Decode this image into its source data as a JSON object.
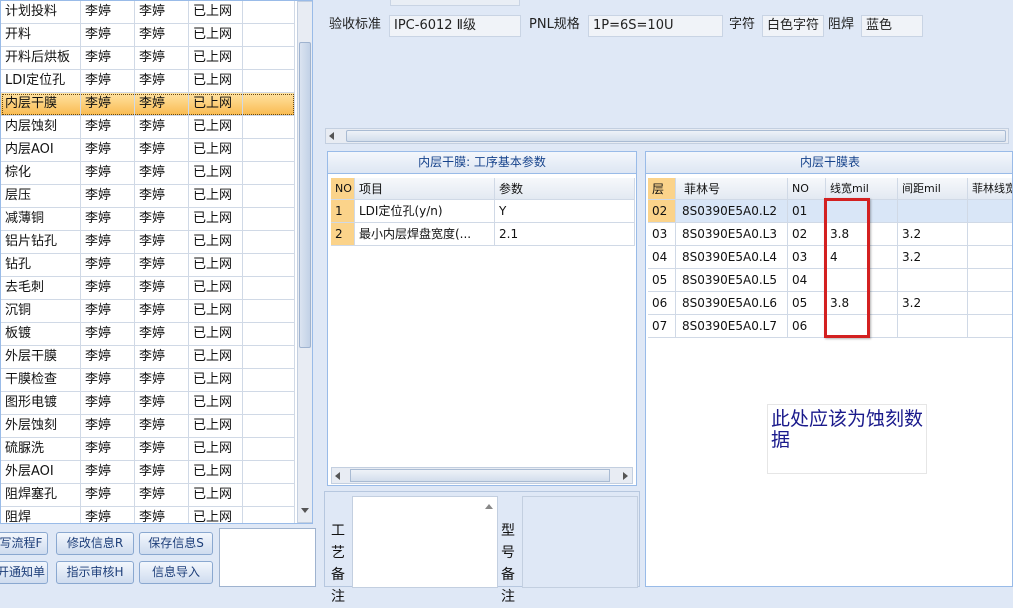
{
  "process_list": [
    {
      "step": "计划投料",
      "a": "李婷",
      "b": "李婷",
      "status": "已上网"
    },
    {
      "step": "开料",
      "a": "李婷",
      "b": "李婷",
      "status": "已上网"
    },
    {
      "step": "开料后烘板",
      "a": "李婷",
      "b": "李婷",
      "status": "已上网"
    },
    {
      "step": "LDI定位孔",
      "a": "李婷",
      "b": "李婷",
      "status": "已上网"
    },
    {
      "step": "内层干膜",
      "a": "李婷",
      "b": "李婷",
      "status": "已上网"
    },
    {
      "step": "内层蚀刻",
      "a": "李婷",
      "b": "李婷",
      "status": "已上网"
    },
    {
      "step": "内层AOI",
      "a": "李婷",
      "b": "李婷",
      "status": "已上网"
    },
    {
      "step": "棕化",
      "a": "李婷",
      "b": "李婷",
      "status": "已上网"
    },
    {
      "step": "层压",
      "a": "李婷",
      "b": "李婷",
      "status": "已上网"
    },
    {
      "step": "减薄铜",
      "a": "李婷",
      "b": "李婷",
      "status": "已上网"
    },
    {
      "step": "铝片钻孔",
      "a": "李婷",
      "b": "李婷",
      "status": "已上网"
    },
    {
      "step": "钻孔",
      "a": "李婷",
      "b": "李婷",
      "status": "已上网"
    },
    {
      "step": "去毛刺",
      "a": "李婷",
      "b": "李婷",
      "status": "已上网"
    },
    {
      "step": "沉铜",
      "a": "李婷",
      "b": "李婷",
      "status": "已上网"
    },
    {
      "step": "板镀",
      "a": "李婷",
      "b": "李婷",
      "status": "已上网"
    },
    {
      "step": "外层干膜",
      "a": "李婷",
      "b": "李婷",
      "status": "已上网"
    },
    {
      "step": "干膜检查",
      "a": "李婷",
      "b": "李婷",
      "status": "已上网"
    },
    {
      "step": "图形电镀",
      "a": "李婷",
      "b": "李婷",
      "status": "已上网"
    },
    {
      "step": "外层蚀刻",
      "a": "李婷",
      "b": "李婷",
      "status": "已上网"
    },
    {
      "step": "硫脲洗",
      "a": "李婷",
      "b": "李婷",
      "status": "已上网"
    },
    {
      "step": "外层AOI",
      "a": "李婷",
      "b": "李婷",
      "status": "已上网"
    },
    {
      "step": "阻焊塞孔",
      "a": "李婷",
      "b": "李婷",
      "status": "已上网"
    },
    {
      "step": "阻焊",
      "a": "李婷",
      "b": "李婷",
      "status": "已上网"
    }
  ],
  "selected_process_index": 4,
  "buttons": {
    "flow": "写流程F",
    "modify": "修改信息R",
    "save": "保存信息S",
    "notify": "开通知单",
    "review": "指示审核H",
    "import": "信息导入"
  },
  "spec": {
    "accept_label": "验收标准",
    "accept_value": "IPC-6012 Ⅱ级",
    "pnl_label": "PNL规格",
    "pnl_value": "1P=6S=10U",
    "char_label": "字符",
    "char_value": "白色字符",
    "mask_label": "阻焊",
    "mask_value": "蓝色"
  },
  "params_panel": {
    "title": "内层干膜: 工序基本参数",
    "columns": [
      "NO",
      "项目",
      "参数"
    ],
    "rows": [
      {
        "no": "1",
        "item": "LDI定位孔(y/n)",
        "value": "Y"
      },
      {
        "no": "2",
        "item": "最小内层焊盘宽度(...",
        "value": "2.1"
      }
    ]
  },
  "film_table": {
    "title": "内层干膜表",
    "columns": [
      "层",
      "菲林号",
      "NO",
      "线宽mil",
      "间距mil",
      "菲林线宽"
    ],
    "rows": [
      {
        "layer": "02",
        "film": "8S0390E5A0.L2",
        "no": "01",
        "width": "",
        "spacing": ""
      },
      {
        "layer": "03",
        "film": "8S0390E5A0.L3",
        "no": "02",
        "width": "3.8",
        "spacing": "3.2"
      },
      {
        "layer": "04",
        "film": "8S0390E5A0.L4",
        "no": "03",
        "width": "4",
        "spacing": "3.2"
      },
      {
        "layer": "05",
        "film": "8S0390E5A0.L5",
        "no": "04",
        "width": "",
        "spacing": ""
      },
      {
        "layer": "06",
        "film": "8S0390E5A0.L6",
        "no": "05",
        "width": "3.8",
        "spacing": "3.2"
      },
      {
        "layer": "07",
        "film": "8S0390E5A0.L7",
        "no": "06",
        "width": "",
        "spacing": ""
      }
    ]
  },
  "annotation": "此处应该为蚀刻数据",
  "bottom": {
    "process_note": "工艺备注",
    "model_note": "型号备注"
  },
  "colors": {
    "selected_row": "#fbbf4b",
    "highlight_box": "#d32020",
    "annotation_text": "#1a1a8c",
    "header_text": "#15428b"
  }
}
